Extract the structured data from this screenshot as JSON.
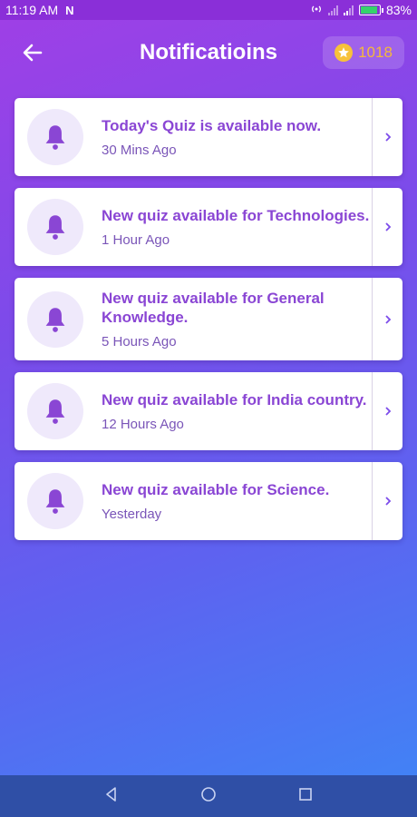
{
  "status": {
    "time": "11:19 AM",
    "app_badge": "N",
    "battery_percent": "83%"
  },
  "header": {
    "title": "Notificatioins",
    "coins": "1018"
  },
  "notifications": [
    {
      "title": "Today's Quiz is available now.",
      "time": "30 Mins Ago"
    },
    {
      "title": "New quiz available for Technologies.",
      "time": "1 Hour Ago"
    },
    {
      "title": "New quiz available for General Knowledge.",
      "time": "5 Hours Ago"
    },
    {
      "title": "New quiz available for India country.",
      "time": "12 Hours Ago"
    },
    {
      "title": "New quiz available for Science.",
      "time": "Yesterday"
    }
  ],
  "colors": {
    "accent": "#8a46d4",
    "coin": "#f5b83b"
  }
}
